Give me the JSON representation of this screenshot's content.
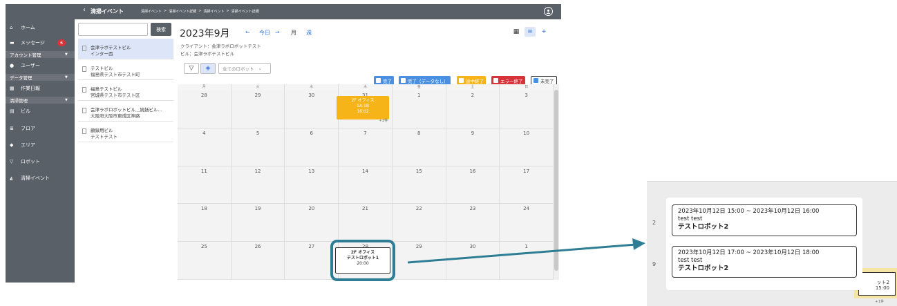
{
  "topbar": {
    "back_icon": "chevron-left-icon",
    "title": "清掃イベント",
    "breadcrumbs": [
      "清掃イベント",
      "清掃イベント詳細",
      "清掃イベント",
      "清掃イベント詳細"
    ],
    "separator": ">",
    "user_icon": "user-circle-icon"
  },
  "sidebar": {
    "items": [
      {
        "label": "ホーム",
        "icon": "home-icon",
        "glyph": "⌂"
      },
      {
        "label": "メッセージ",
        "icon": "message-icon",
        "glyph": "▬",
        "badge": "6"
      },
      {
        "label": "ユーザー",
        "icon": "user-icon",
        "glyph": "●"
      },
      {
        "label": "作業日報",
        "icon": "report-icon",
        "glyph": "▦"
      },
      {
        "label": "ビル",
        "icon": "building-icon",
        "glyph": "▤"
      },
      {
        "label": "フロア",
        "icon": "floor-icon",
        "glyph": "≣"
      },
      {
        "label": "エリア",
        "icon": "area-icon",
        "glyph": "◆"
      },
      {
        "label": "ロボット",
        "icon": "robot-icon",
        "glyph": "▽"
      },
      {
        "label": "清掃イベント",
        "icon": "cleaning-icon",
        "glyph": "◭"
      }
    ],
    "sections": [
      {
        "label": "アカウント管理"
      },
      {
        "label": "データ管理"
      },
      {
        "label": "清掃管理"
      }
    ]
  },
  "list": {
    "search_placeholder": "",
    "search_button": "検索",
    "buildings": [
      {
        "name": "会津ラボテストビル",
        "address": "インター西",
        "selected": true
      },
      {
        "name": "テストビル",
        "address": "福島県テスト市テスト町"
      },
      {
        "name": "福島テストビル",
        "address": "宮城県テスト市テスト区"
      },
      {
        "name": "会津ラボロボットビル＿続括ビル…",
        "address": "大阪府大阪市東成区神路"
      },
      {
        "name": "顧録用ビル",
        "address": "テストテスト"
      }
    ]
  },
  "calendar": {
    "month_title": "2023年9月",
    "prev": "←",
    "today": "今日",
    "next": "→",
    "view_month": "月",
    "view_week": "週",
    "client": "クライアント：会津ラボロボットテスト",
    "building": "ビル：会津ラボテストビル",
    "robot_select": "全てのロボット",
    "legend": [
      {
        "label": "完了",
        "color": "#4a90e2"
      },
      {
        "label": "完了（データなし）",
        "color": "#4a90e2"
      },
      {
        "label": "途中終了",
        "color": "#f6b418"
      },
      {
        "label": "エラー終了",
        "color": "#d9333a"
      },
      {
        "label": "未完了",
        "color": "#ffffff"
      }
    ],
    "weekdays": [
      "月",
      "火",
      "水",
      "木",
      "金",
      "土",
      "日"
    ],
    "weeks": [
      [
        "28",
        "29",
        "30",
        "31",
        "1",
        "2",
        "3"
      ],
      [
        "4",
        "5",
        "6",
        "7",
        "8",
        "9",
        "10"
      ],
      [
        "11",
        "12",
        "13",
        "14",
        "15",
        "16",
        "17"
      ],
      [
        "18",
        "19",
        "20",
        "21",
        "22",
        "23",
        "24"
      ],
      [
        "25",
        "26",
        "27",
        "28",
        "29",
        "30",
        "1"
      ]
    ],
    "event_orange": {
      "line1": "2F オフィス",
      "line2": "1A-1B",
      "line3": "16:02"
    },
    "more": "＋2件",
    "event_white": {
      "line1": "2F オフィス",
      "line2": "テストロボット1",
      "line3": "20:00"
    }
  },
  "zoom": {
    "events": [
      {
        "time": "2023年10月12日 15:00 ~ 2023年10月12日 16:00",
        "title": "test test",
        "robot": "テストロボット2"
      },
      {
        "time": "2023年10月12日 17:00 ~ 2023年10月12日 18:00",
        "title": "test test",
        "robot": "テストロボット2"
      }
    ],
    "bg_day_a": "2",
    "bg_day_b": "9",
    "bg_event_robot": "ット2",
    "bg_event_time": "15:00",
    "bg_more": "＋1件"
  },
  "colors": {
    "sidebar": "#5a6068",
    "accent": "#3a74d6",
    "highlight": "#2d7e94"
  }
}
